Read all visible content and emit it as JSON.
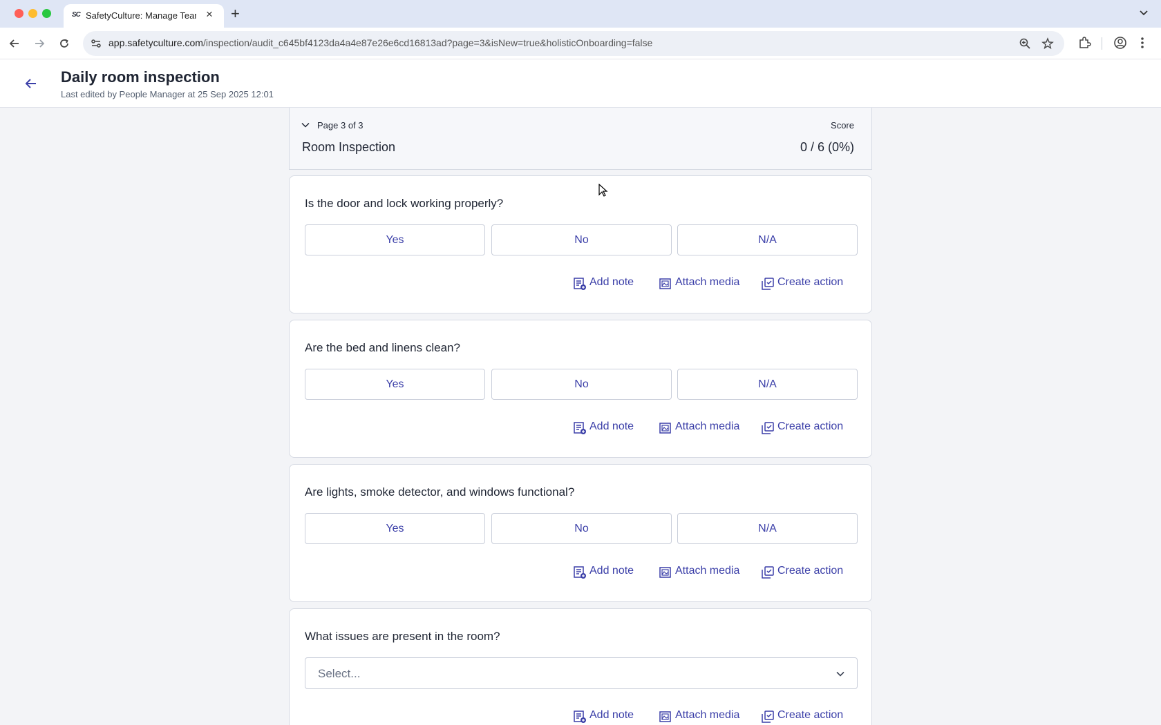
{
  "browser": {
    "tab_title": "SafetyCulture: Manage Teams",
    "tab_favicon": "SC",
    "url_host": "app.safetyculture.com",
    "url_path": "/inspection/audit_c645bf4123da4a4e87e26e6cd16813ad?page=3&isNew=true&holisticOnboarding=false",
    "icons": [
      "back-icon",
      "forward-icon",
      "reload-icon",
      "site-settings-icon",
      "zoom-icon",
      "star-icon",
      "extensions-icon",
      "profile-icon",
      "menu-icon"
    ]
  },
  "header": {
    "title": "Daily room inspection",
    "subtitle": "Last edited by People Manager at 25 Sep 2025 12:01"
  },
  "page_section": {
    "page_label": "Page 3 of 3",
    "score_label": "Score",
    "title": "Room Inspection",
    "score_value": "0 / 6 (0%)"
  },
  "questions": [
    {
      "text": "Is the door and lock working properly?",
      "responses": [
        "Yes",
        "No",
        "N/A"
      ]
    },
    {
      "text": "Are the bed and linens clean?",
      "responses": [
        "Yes",
        "No",
        "N/A"
      ]
    },
    {
      "text": "Are lights, smoke detector, and windows functional?",
      "responses": [
        "Yes",
        "No",
        "N/A"
      ]
    },
    {
      "text": "What issues are present in the room?",
      "select_placeholder": "Select..."
    }
  ],
  "actions": {
    "add_note": "Add note",
    "attach_media": "Attach media",
    "create_action": "Create action"
  },
  "colors": {
    "accent": "#3b3fa8",
    "background": "#f3f4f7",
    "border": "#d6dae3"
  }
}
